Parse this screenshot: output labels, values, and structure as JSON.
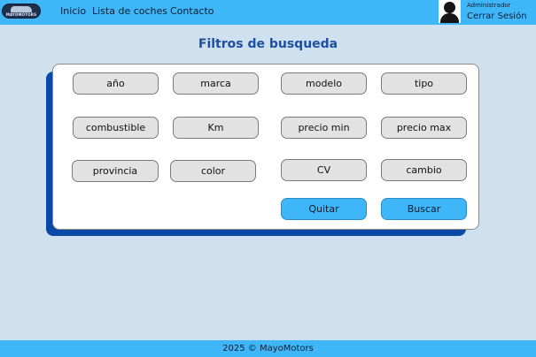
{
  "header": {
    "logo_text": "MAYOMOTORS",
    "nav": {
      "inicio": "Inicio",
      "lista": "Lista de coches",
      "contacto": "Contacto"
    },
    "user": {
      "role": "Administrador",
      "logout": "Cerrar Sesión"
    }
  },
  "main": {
    "title": "Filtros de busqueda",
    "filters": {
      "anio": "año",
      "marca": "marca",
      "modelo": "modelo",
      "tipo": "tipo",
      "combustible": "combustible",
      "km": "Km",
      "precio_min": "precio min",
      "precio_max": "precio max",
      "provincia": "provincia",
      "color": "color",
      "cv": "CV",
      "cambio": "cambio"
    },
    "actions": {
      "quitar": "Quitar",
      "buscar": "Buscar"
    }
  },
  "footer": {
    "text": "2025 © MayoMotors"
  },
  "colors": {
    "topbar": "#3fb6f7",
    "background": "#cfe0ef",
    "title": "#1d4fa3",
    "card_shadow": "#0b49a6",
    "filter_button": "#e2e2e2",
    "action_button": "#3fb6f7"
  }
}
